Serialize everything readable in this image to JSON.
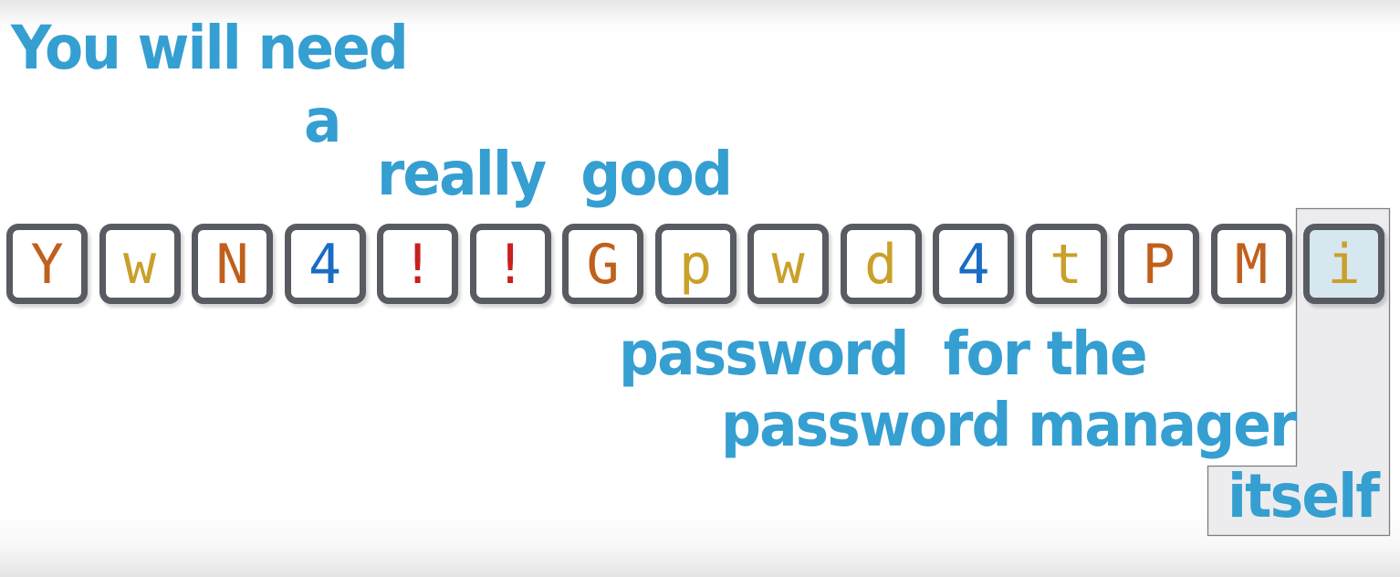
{
  "phrases": {
    "line1": "You will need",
    "line2": "a",
    "line3": "really  good",
    "line4": "password  for the",
    "line5": "password manager",
    "line6": "itself"
  },
  "password": {
    "characters": [
      {
        "char": "Y",
        "color": "#c0601c"
      },
      {
        "char": "w",
        "color": "#c9a02a"
      },
      {
        "char": "N",
        "color": "#c0601c"
      },
      {
        "char": "4",
        "color": "#1a6cc4"
      },
      {
        "char": "!",
        "color": "#c8201e"
      },
      {
        "char": "!",
        "color": "#c8201e"
      },
      {
        "char": "G",
        "color": "#c0601c"
      },
      {
        "char": "p",
        "color": "#c9a02a"
      },
      {
        "char": "w",
        "color": "#c9a02a"
      },
      {
        "char": "d",
        "color": "#c9a02a"
      },
      {
        "char": "4",
        "color": "#1a6cc4"
      },
      {
        "char": "t",
        "color": "#c9a02a"
      },
      {
        "char": "P",
        "color": "#c0601c"
      },
      {
        "char": "M",
        "color": "#c0601c"
      },
      {
        "char": "i",
        "color": "#c9a02a",
        "highlighted": true
      }
    ]
  },
  "colors": {
    "text_blue": "#359fd1",
    "tile_border": "#585b62",
    "highlight_fill": "#d7e7ef",
    "panel_fill": "#ececee",
    "panel_border": "#7d7d80"
  }
}
